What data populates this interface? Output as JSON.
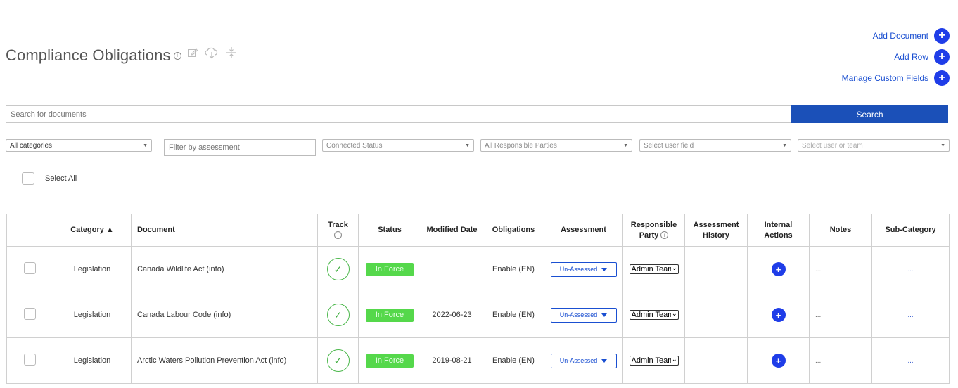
{
  "header": {
    "title": "Compliance Obligations",
    "info_glyph": "i",
    "icons": [
      "info-icon",
      "edit-icon",
      "cloud-download-icon",
      "compress-icon"
    ]
  },
  "actions": {
    "add_document": "Add Document",
    "add_row": "Add Row",
    "manage_custom_fields": "Manage Custom Fields",
    "plus_glyph": "+"
  },
  "search": {
    "placeholder": "Search for documents",
    "button": "Search"
  },
  "filters": {
    "categories": "All categories",
    "assessment_placeholder": "Filter by assessment",
    "connected_status": "Connected Status",
    "responsible_parties": "All Responsible Parties",
    "user_field": "Select user field",
    "user_or_team": "Select user or team"
  },
  "select_all": "Select All",
  "table": {
    "headers": {
      "category": "Category ▲",
      "document": "Document",
      "track": "Track",
      "status": "Status",
      "modified_date": "Modified Date",
      "obligations": "Obligations",
      "assessment": "Assessment",
      "responsible_party_1": "Responsible",
      "responsible_party_2": "Party",
      "assessment_history_1": "Assessment",
      "assessment_history_2": "History",
      "internal_actions_1": "Internal",
      "internal_actions_2": "Actions",
      "notes": "Notes",
      "sub_category": "Sub-Category"
    },
    "rows": [
      {
        "category": "Legislation",
        "document": "Canada Wildlife Act (info)",
        "status": "In Force",
        "modified_date": "",
        "obligations": "Enable (EN)",
        "assessment": "Un-Assessed",
        "responsible_party": "Admin Team",
        "notes": "...",
        "sub_category": "..."
      },
      {
        "category": "Legislation",
        "document": "Canada Labour Code (info)",
        "status": "In Force",
        "modified_date": "2022-06-23",
        "obligations": "Enable (EN)",
        "assessment": "Un-Assessed",
        "responsible_party": "Admin Team",
        "notes": "...",
        "sub_category": "..."
      },
      {
        "category": "Legislation",
        "document": "Arctic Waters Pollution Prevention Act (info)",
        "status": "In Force",
        "modified_date": "2019-08-21",
        "obligations": "Enable (EN)",
        "assessment": "Un-Assessed",
        "responsible_party": "Admin Team",
        "notes": "...",
        "sub_category": "..."
      }
    ]
  },
  "colors": {
    "accent_blue": "#1f3de8",
    "search_button": "#1b50b8",
    "link": "#1a4fd1",
    "status_green": "#55d84b",
    "track_green": "#3fae3f"
  }
}
